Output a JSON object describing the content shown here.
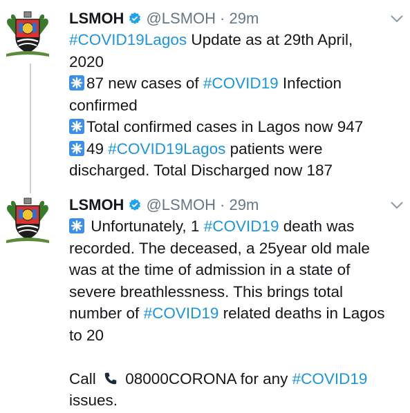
{
  "tweets": [
    {
      "name": "LSMOH",
      "handle": "@LSMOH",
      "time": "· 29m",
      "lines": {
        "l1_tag": "#COVID19Lagos",
        "l1_text": " Update as at 29th April,",
        "l2_text": "2020",
        "l3_text": "87 new cases of ",
        "l3_tag": "#COVID19",
        "l3_text2": " Infection",
        "l4_text": "confirmed",
        "l5_text": "Total confirmed cases in Lagos now 947",
        "l6_text": "49 ",
        "l6_tag": "#COVID19Lagos",
        "l6_text2": " patients were",
        "l7_text": "discharged. Total Discharged now 187"
      }
    },
    {
      "name": "LSMOH",
      "handle": "@LSMOH",
      "time": "· 29m",
      "lines": {
        "l1_text": " Unfortunately, 1 ",
        "l1_tag": "#COVID19",
        "l1_text2": " death was",
        "l2_text": "recorded. The deceased, a 25year old male",
        "l3_text": "was at the time of admission in a state of",
        "l4_text": "severe breathlessness. This brings total",
        "l5_text": "number of ",
        "l5_tag": "#COVID19",
        "l5_text2": " related deaths in Lagos",
        "l6_text": "to 20",
        "l8_text": "Call ",
        "l8_text2": " 08000CORONA for any ",
        "l8_tag": "#COVID19",
        "l9_text": "issues."
      }
    }
  ],
  "icons": {
    "verified": "verified-badge-icon",
    "chevron": "chevron-down-icon",
    "sparkle": "sparkle-emoji-icon",
    "phone": "telephone-receiver-icon",
    "avatar": "lagos-state-coat-of-arms"
  },
  "colors": {
    "hashtag": "#1b95e0",
    "verified": "#1da1f2",
    "meta": "#657786",
    "sparkle_bg": "#3b8eea"
  }
}
